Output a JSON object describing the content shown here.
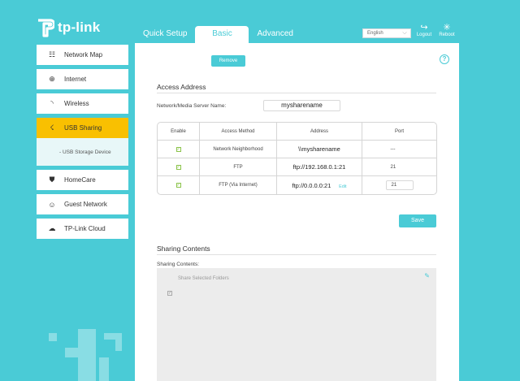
{
  "header": {
    "brand": "tp-link",
    "tabs": [
      {
        "label": "Quick Setup",
        "active": false
      },
      {
        "label": "Basic",
        "active": true
      },
      {
        "label": "Advanced",
        "active": false
      }
    ],
    "language": "English",
    "logout_label": "Logout",
    "reboot_label": "Reboot"
  },
  "sidebar": {
    "items": [
      {
        "label": "Network Map",
        "icon": "network-map-icon"
      },
      {
        "label": "Internet",
        "icon": "globe-icon"
      },
      {
        "label": "Wireless",
        "icon": "wifi-icon"
      },
      {
        "label": "USB Sharing",
        "icon": "usb-icon",
        "active": true
      },
      {
        "label": "HomeCare",
        "icon": "shield-icon"
      },
      {
        "label": "Guest Network",
        "icon": "guest-icon"
      },
      {
        "label": "TP-Link Cloud",
        "icon": "cloud-icon"
      }
    ],
    "sub_item": "- USB Storage Device"
  },
  "main": {
    "remove_label": "Remove",
    "access_title": "Access Address",
    "server_name_label": "Network/Media Server Name:",
    "server_name_value": "mysharename",
    "table": {
      "headers": [
        "Enable",
        "Access Method",
        "Address",
        "Port"
      ],
      "rows": [
        {
          "method": "Network Neighborhood",
          "address": "\\\\mysharename",
          "port": "---",
          "edit": ""
        },
        {
          "method": "FTP",
          "address": "ftp://192.168.0.1:21",
          "port": "21",
          "edit": ""
        },
        {
          "method": "FTP (Via Internet)",
          "address": "ftp://0.0.0.0:21",
          "port": "21",
          "edit": "Edit"
        }
      ]
    },
    "save_label": "Save",
    "sharing_title": "Sharing Contents",
    "sharing_label": "Sharing Contents:",
    "share_selected_label": "Share Selected Folders"
  },
  "colors": {
    "accent": "#4acbd6",
    "active_sidebar": "#f9c001"
  }
}
